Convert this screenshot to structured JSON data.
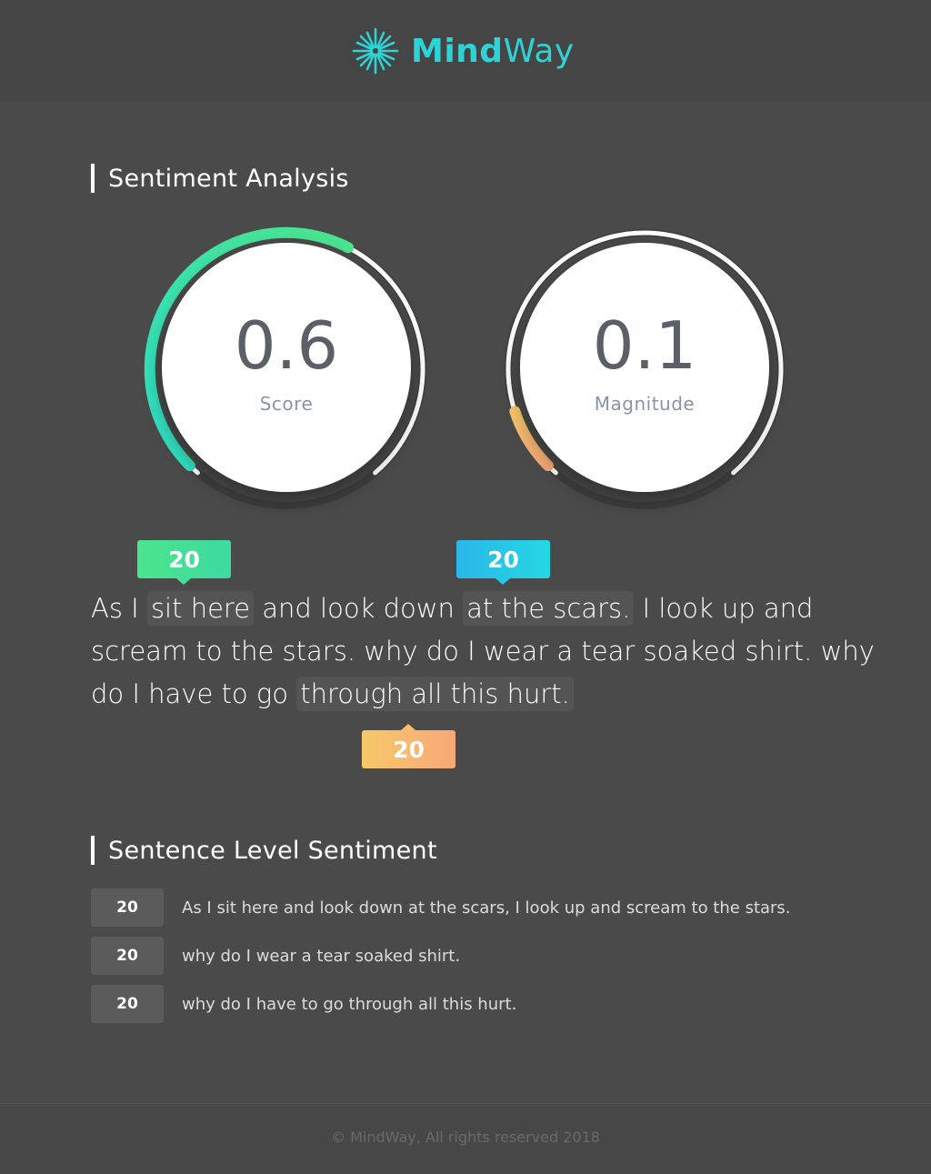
{
  "header": {
    "logo_icon": "starburst-icon",
    "brand_bold": "Mind",
    "brand_light": "Way",
    "brand_color": "#2ed3d6"
  },
  "sections": {
    "sentiment_title": "Sentiment Analysis",
    "sentence_title": "Sentence Level Sentiment"
  },
  "gauges": {
    "score": {
      "value": "0.6",
      "label": "Score",
      "level": 0.6,
      "colors": [
        "#4be58d",
        "#2ee0c6"
      ]
    },
    "magnitude": {
      "value": "0.1",
      "label": "Magnitude",
      "level": 0.1,
      "colors": [
        "#f7c86a",
        "#f8a877"
      ]
    }
  },
  "passage": {
    "bubbles": [
      "20",
      "20",
      "20"
    ],
    "line1": {
      "a": "As I ",
      "hl1": "sit here",
      "b": " and look down ",
      "hl2": "at the scars.",
      "c": " I look up and"
    },
    "line2": "scream to the stars. why do I wear a tear soaked shirt. why",
    "line3": {
      "a": "do I have to go ",
      "hl3": "through all this hurt."
    }
  },
  "sentences": [
    {
      "score": "20",
      "text": "As I sit here and look down at the scars, I look up and scream to the stars."
    },
    {
      "score": "20",
      "text": "why do I wear a tear soaked shirt."
    },
    {
      "score": "20",
      "text": "why do I have to go through all this hurt."
    }
  ],
  "footer": {
    "copyright": "© MindWay, All rights reserved 2018"
  }
}
